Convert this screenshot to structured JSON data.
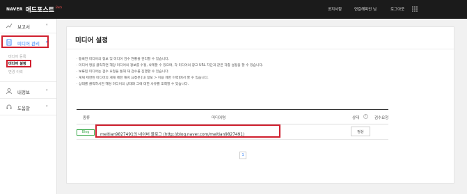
{
  "topbar": {
    "brand_naver": "NAVER",
    "brand_service": "애드포스트",
    "brand_beta": "Beta",
    "links": [
      "공지사항",
      "연갈해피안 님",
      "로그아웃"
    ],
    "apps_icon": "grid-icon"
  },
  "sidebar": {
    "items": [
      {
        "label": "보고서",
        "icon": "chart-line-icon"
      },
      {
        "label": "미디어 관리",
        "icon": "document-icon"
      },
      {
        "label": "내정보",
        "icon": "user-icon"
      },
      {
        "label": "도움말",
        "icon": "headset-icon"
      }
    ],
    "sub_items": [
      "미디어 등록",
      "미디어 설정",
      "변경 이력"
    ],
    "active_color": "#2f7df6"
  },
  "main": {
    "title": "미디어 설정",
    "notes": [
      "· 등록한 미디어의 정보 및 미디어 검수 현황을 관리할 수 있습니다.",
      "· 미디어 명을 클릭하면 해당 미디어의 정보를 수정, 삭제할 수 있으며, 각 미디어의 광고 URL 차단과 같은 각종 설정을 할 수 있습니다.",
      "· 보류된 미디어는 검수 요청을 통해 재 검수를 진행할 수 있습니다.",
      "· 게재 제한된 미디어의 게재 제한 해지 요청은 [내 정보 > 이용 제한 이력]에서 할 수 있습니다.",
      "· 상태를 클릭하시면 해당 미디어의 상태와 그에 대한 사유를 조회할 수 있습니다."
    ],
    "table": {
      "headers": [
        "종류",
        "미디어명",
        "상태",
        "검수요청"
      ],
      "rows": [
        {
          "type": "Blog",
          "name": "meitian9827491의 네이버 블로그 (http://blog.naver.com/meitian9827491)",
          "status": "정상"
        }
      ]
    },
    "pagination": {
      "current": "1"
    }
  },
  "colors": {
    "highlight": "#d01f2e",
    "badge_green": "#39a94a",
    "topbar": "#1b1b1b"
  }
}
